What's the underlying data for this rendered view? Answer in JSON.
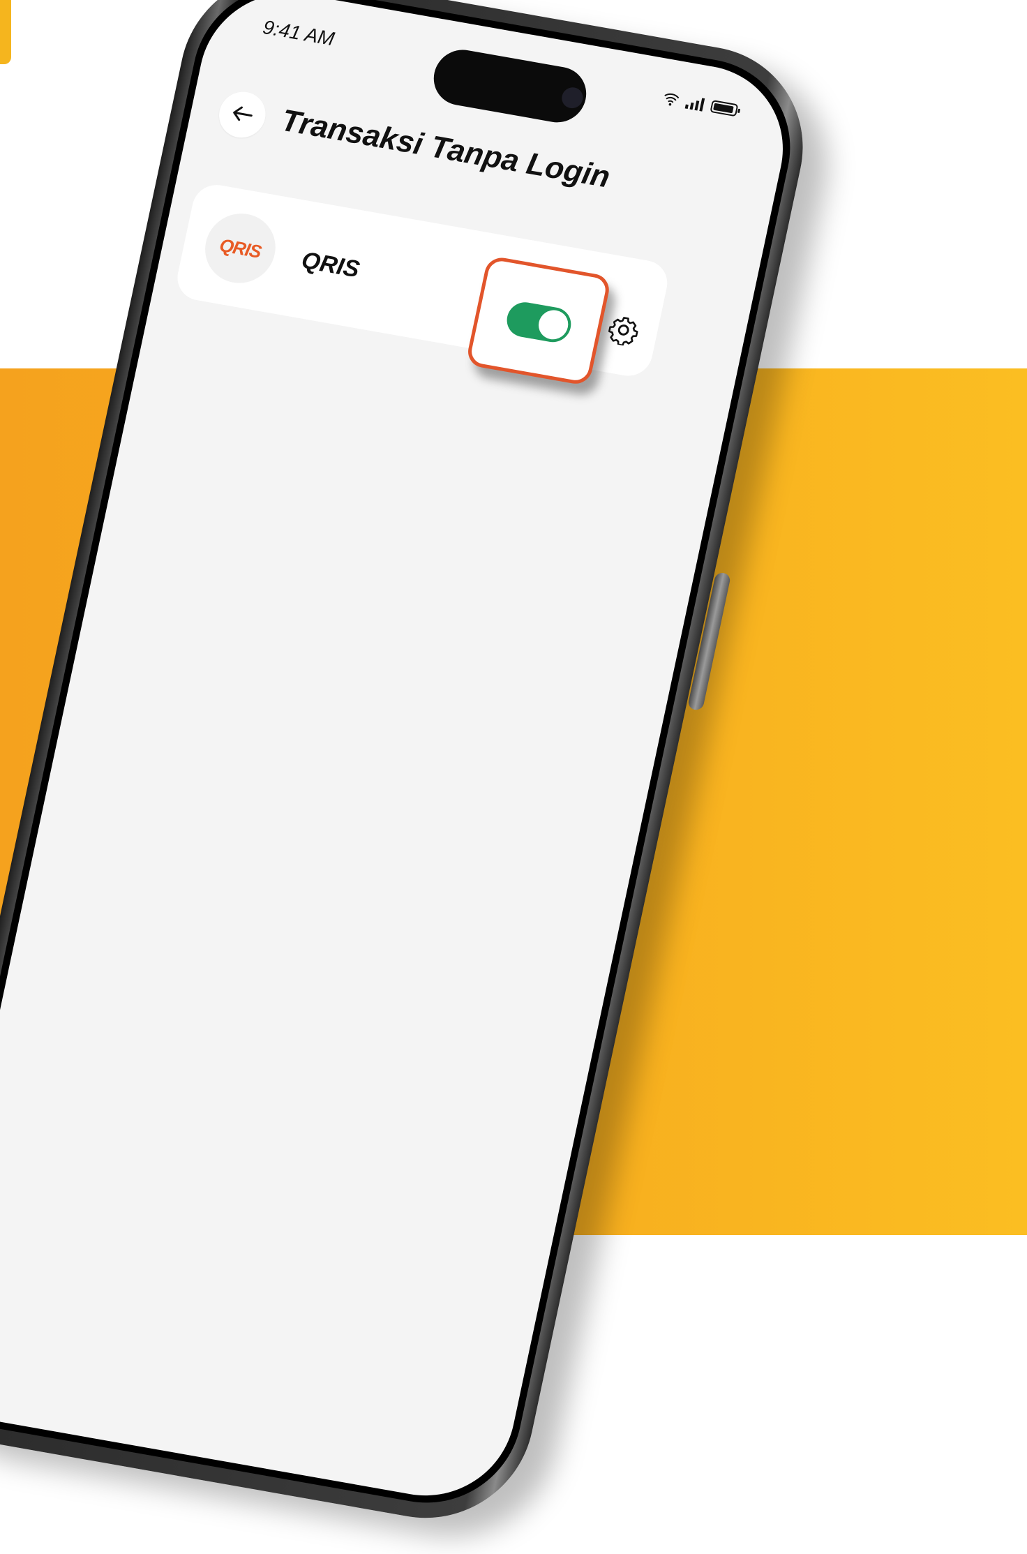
{
  "colors": {
    "accent_orange": "#F5A21E",
    "highlight": "#E2552B",
    "toggle_on": "#1E9B5E",
    "qris_logo": "#E85B25"
  },
  "status_bar": {
    "time": "9:41 AM",
    "icons": [
      "wifi-icon",
      "signal-icon",
      "battery-icon"
    ]
  },
  "header": {
    "back_icon": "arrow-left-icon",
    "title": "Transaksi Tanpa Login"
  },
  "items": [
    {
      "logo_text": "QRIS",
      "label": "QRIS",
      "toggle_on": true,
      "settings_icon": "gear-icon"
    }
  ]
}
